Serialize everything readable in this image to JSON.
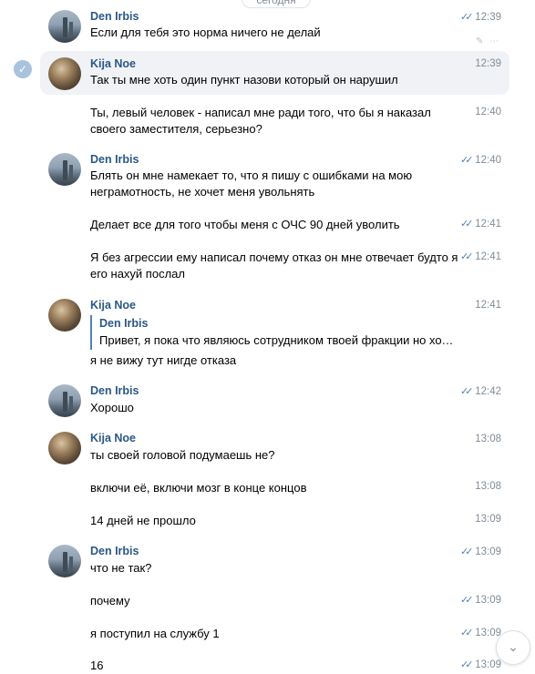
{
  "date_label": "сегодня",
  "icons": {
    "read_check": "double-check-icon",
    "selected": "checkmark-circle-icon",
    "scroll_down": "chevron-down-icon",
    "actions": "more-actions-icon"
  },
  "messages": [
    {
      "author": "Den Irbis",
      "text": "Если для тебя это норма ничего не делай",
      "time": "12:39",
      "read": true
    },
    {
      "author": "Kija Noe",
      "text": "Так ты мне хоть один пункт назови который он нарушил",
      "time": "12:39",
      "read": false
    },
    {
      "author": "",
      "text": "Ты, левый человек - написал мне ради того, что бы я наказал своего заместителя, серьезно?",
      "time": "12:40",
      "read": false
    },
    {
      "author": "Den Irbis",
      "text": "Блять он мне намекает то, что я пишу с ошибками на мою неграмотность, не хочет меня увольнять",
      "time": "12:40",
      "read": true
    },
    {
      "author": "",
      "text": "Делает все для того чтобы меня с ОЧС 90 дней уволить",
      "time": "12:41",
      "read": true
    },
    {
      "author": "",
      "text": "Я без агрессии ему написал почему отказ он мне отвечает будто я его нахуй послал",
      "time": "12:41",
      "read": true
    },
    {
      "author": "Kija Noe",
      "reply_author": "Den Irbis",
      "reply_text": "Привет, я пока что являюсь сотрудником твоей фракции но хочу уйти",
      "text": "я не вижу тут нигде отказа",
      "time": "12:41",
      "read": false
    },
    {
      "author": "Den Irbis",
      "text": "Хорошо",
      "time": "12:42",
      "read": true
    },
    {
      "author": "Kija Noe",
      "text": "ты своей головой подумаешь не?",
      "time": "13:08",
      "read": false
    },
    {
      "author": "",
      "text": "включи её, включи мозг в конце концов",
      "time": "13:08",
      "read": false
    },
    {
      "author": "",
      "text": "14 дней не прошло",
      "time": "13:09",
      "read": false
    },
    {
      "author": "Den Irbis",
      "text": "что не так?",
      "time": "13:09",
      "read": true
    },
    {
      "author": "",
      "text": "почему",
      "time": "13:09",
      "read": true
    },
    {
      "author": "",
      "text": "я поступил на службу 1",
      "time": "13:09",
      "read": true
    },
    {
      "author": "",
      "text": "16",
      "time": "13:09",
      "read": true
    }
  ]
}
